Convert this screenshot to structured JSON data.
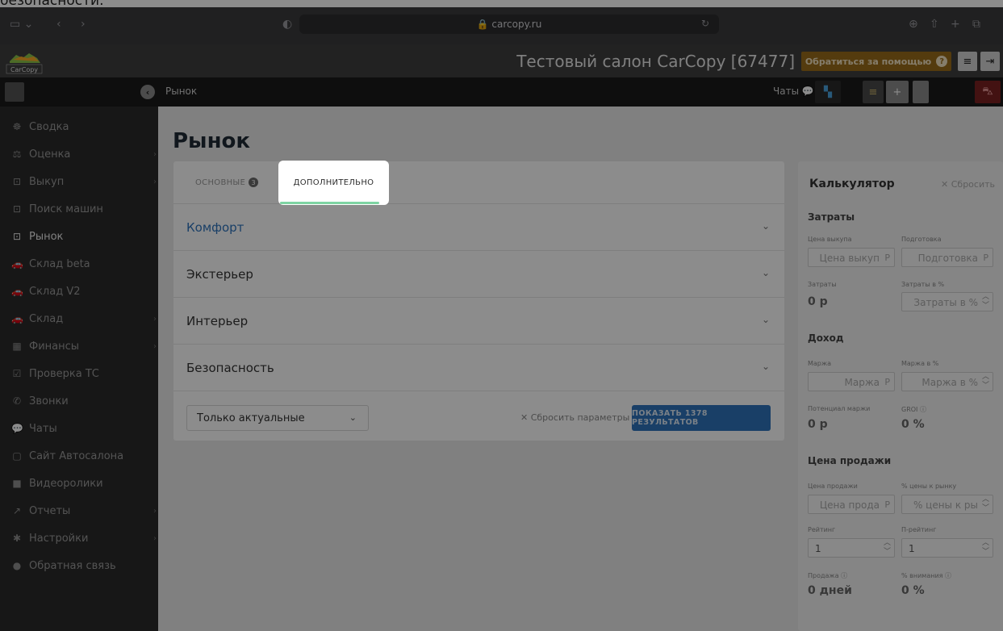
{
  "top_text": "безопасности.",
  "browser": {
    "url": "carcopy.ru"
  },
  "header": {
    "logo_text": "CarCopy",
    "salon_title": "Тестовый салон CarCopy [67477]",
    "help_label": "Обратиться за помощью",
    "help_icon": "?",
    "menu_icon": "≡",
    "logout_icon": "⇥"
  },
  "subheader": {
    "breadcrumb": "Рынок",
    "chats_label": "Чаты",
    "plus_label": "+"
  },
  "sidebar": {
    "items": [
      {
        "icon": "☸",
        "label": "Сводка"
      },
      {
        "icon": "⚖",
        "label": "Оценка"
      },
      {
        "icon": "⊡",
        "label": "Выкуп"
      },
      {
        "icon": "⊡",
        "label": "Поиск машин"
      },
      {
        "icon": "⊡",
        "label": "Рынок"
      },
      {
        "icon": "🚗",
        "label": "Склад beta"
      },
      {
        "icon": "🚗",
        "label": "Склад V2"
      },
      {
        "icon": "🚗",
        "label": "Склад"
      },
      {
        "icon": "▦",
        "label": "Финансы"
      },
      {
        "icon": "☑",
        "label": "Проверка ТС"
      },
      {
        "icon": "✆",
        "label": "Звонки"
      },
      {
        "icon": "💬",
        "label": "Чаты"
      },
      {
        "icon": "▢",
        "label": "Сайт Автосалона"
      },
      {
        "icon": "■",
        "label": "Видеоролики"
      },
      {
        "icon": "↗",
        "label": "Отчеты"
      },
      {
        "icon": "✱",
        "label": "Настройки"
      },
      {
        "icon": "●",
        "label": "Обратная связь"
      }
    ]
  },
  "page": {
    "title": "Рынок",
    "tabs": {
      "main_label": "ОСНОВНЫЕ",
      "main_badge": "3",
      "extra_label": "ДОПОЛНИТЕЛЬНО"
    },
    "sections": [
      "Комфорт",
      "Экстерьер",
      "Интерьер",
      "Безопасность"
    ],
    "filter_value": "Только актуальные",
    "reset_label": "✕ Сбросить параметры",
    "show_label": "ПОКАЗАТЬ 1378 РЕЗУЛЬТАТОВ"
  },
  "calculator": {
    "title": "Калькулятор",
    "reset": "✕ Сбросить",
    "costs": {
      "title": "Затраты",
      "buy_label": "Цена выкупа",
      "buy_ph": "Цена выкуп",
      "prep_label": "Подготовка",
      "prep_ph": "Подготовка",
      "costs_label": "Затраты",
      "costs_value": "0 р",
      "costs_pct_label": "Затраты в %",
      "costs_pct_ph": "Затраты в %"
    },
    "income": {
      "title": "Доход",
      "margin_label": "Маржа",
      "margin_ph": "Маржа",
      "margin_pct_label": "Маржа в %",
      "margin_pct_ph": "Маржа в %",
      "potential_label": "Потенциал маржи",
      "potential_value": "0 р",
      "groi_label": "GROI",
      "groi_value": "0 %"
    },
    "sale": {
      "title": "Цена продажи",
      "price_label": "Цена продажи",
      "price_ph": "Цена прода",
      "pct_label": "% цены к рынку",
      "pct_ph": "% цены к ры",
      "rating_label": "Рейтинг",
      "rating_value": "1",
      "prating_label": "П-рейтинг",
      "prating_value": "1",
      "sale_label": "Продажа",
      "sale_value": "0 дней",
      "attention_label": "% внимания",
      "attention_value": "0 %"
    },
    "currency": "Р"
  },
  "colors": {
    "accent_blue": "#2f74bc",
    "help_orange": "#9a6c1a",
    "active_tab_underline": "#7ed4a3"
  }
}
